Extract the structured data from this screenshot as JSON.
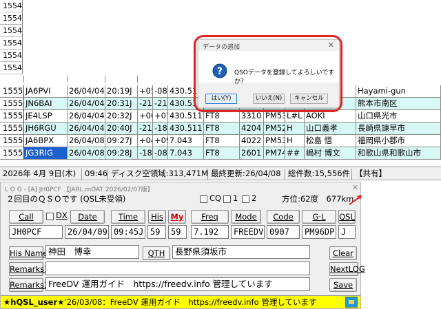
{
  "grid": {
    "top_numbers": [
      "1554",
      "1554",
      "1554",
      "1554",
      "1554",
      "1554"
    ],
    "rows": [
      {
        "no": "15550",
        "call": "JA6PVI",
        "date": "26/04/04",
        "time": "20:19J",
        "rst_s": "+05",
        "rst_r": "-08",
        "freq": "430.511",
        "mode": "FT8",
        "code": "",
        "gl": "",
        "qsl": "",
        "name": "",
        "qth": "Hayami-gun",
        "style": "white"
      },
      {
        "no": "15551",
        "call": "JN6BAI",
        "date": "26/04/04",
        "time": "20:31J",
        "rst_s": "-21",
        "rst_r": "-21",
        "freq": "430.511",
        "mode": "FT8",
        "code": "",
        "gl": "",
        "qsl": "",
        "name": "",
        "qth": "熊本市南区",
        "style": "cyan"
      },
      {
        "no": "15552",
        "call": "JE4LSP",
        "date": "26/04/04",
        "time": "20:32J",
        "rst_s": "+06",
        "rst_r": "+07",
        "freq": "430.511",
        "mode": "FT8",
        "code": "3310",
        "gl": "PM53",
        "qsl": "L#L",
        "name": "AOKI",
        "qth": "山口県光市",
        "style": "white"
      },
      {
        "no": "15553",
        "call": "JH6RGU",
        "date": "26/04/04",
        "time": "20:40J",
        "rst_s": "-21",
        "rst_r": "-18",
        "freq": "430.511",
        "mode": "FT8",
        "code": "4204",
        "gl": "PM52",
        "qsl": "H",
        "name": "山口義孝",
        "qth": "長崎県諫早市",
        "style": "cyan"
      },
      {
        "no": "15554",
        "call": "JA6BPX",
        "date": "26/04/08",
        "time": "09:27J",
        "rst_s": "+04",
        "rst_r": "+09",
        "freq": "7.043",
        "mode": "FT8",
        "code": "4022",
        "gl": "PM53",
        "qsl": "H",
        "name": "松島 悟",
        "qth": "福岡県小郡市",
        "style": "white"
      },
      {
        "no": "15555",
        "call": "JG3RIG",
        "date": "26/04/08",
        "time": "09:28J",
        "rst_s": "-18",
        "rst_r": "-08",
        "freq": "7.043",
        "mode": "FT8",
        "code": "2601",
        "gl": "PM74",
        "qsl": "##",
        "name": "嶋村 博文",
        "qth": "和歌山県和歌山市",
        "style": "cyan"
      }
    ]
  },
  "statusbar": {
    "date": "2026年 4月 9日(木)",
    "time": "09:46",
    "disk": "ディスク空領域:313,471M",
    "updated": "最終更新:26/04/08",
    "total": "総件数:15,556件",
    "shared": "【共有】"
  },
  "dialog": {
    "title": "データの追加",
    "message": "QSOデータを登録してよろしいですか？",
    "buttons": {
      "yes": "はい(Y)",
      "no": "いいえ(N)",
      "cancel": "キャンセル"
    }
  },
  "panel": {
    "title": "L O G - [A]    JH0PCF 【JARL.mDAT 2026/02/07版】",
    "qso_info": "２回目のＱＳＯです (QSL未受領)",
    "cq_label": "CQ",
    "chk1_label": "1",
    "chk2_label": "2",
    "direction": "方位:62度　677km",
    "labels": {
      "call": "Call",
      "dx": "DX",
      "date": "Date",
      "time": "Time",
      "his": "His",
      "my": "My",
      "freq": "Freq",
      "mode": "Mode",
      "code": "Code",
      "gl": "G·L",
      "qsl": "QSL",
      "his_name": "His Name",
      "qth": "QTH",
      "remarks1": "Remarks1",
      "remarks2": "Remarks2",
      "clear": "Clear",
      "nextlog": "NextLOG",
      "save": "Save"
    },
    "values": {
      "call": "JH0PCF",
      "date": "26/04/09",
      "time": "09:45J",
      "his": "59",
      "my": "59",
      "freq": "7.192",
      "mode": "FREEDV",
      "code": "0907",
      "gl": "PM96DP",
      "qsl": "J",
      "his_name": "神田　博幸",
      "qth": "長野県須坂市",
      "remarks1": "",
      "remarks2": "FreeDV 運用ガイド　https://freedv.info 管理しています"
    },
    "userbar": {
      "user": "★hQSL_user★",
      "text": "'26/03/08：FreeDV 運用ガイド　https://freedv.info 管理しています"
    }
  },
  "colors": {
    "row_alt": "#d8f8f6",
    "selected": "#1c5fcf",
    "userbar": "#ffff00",
    "annotation_ring": "#e02424"
  }
}
